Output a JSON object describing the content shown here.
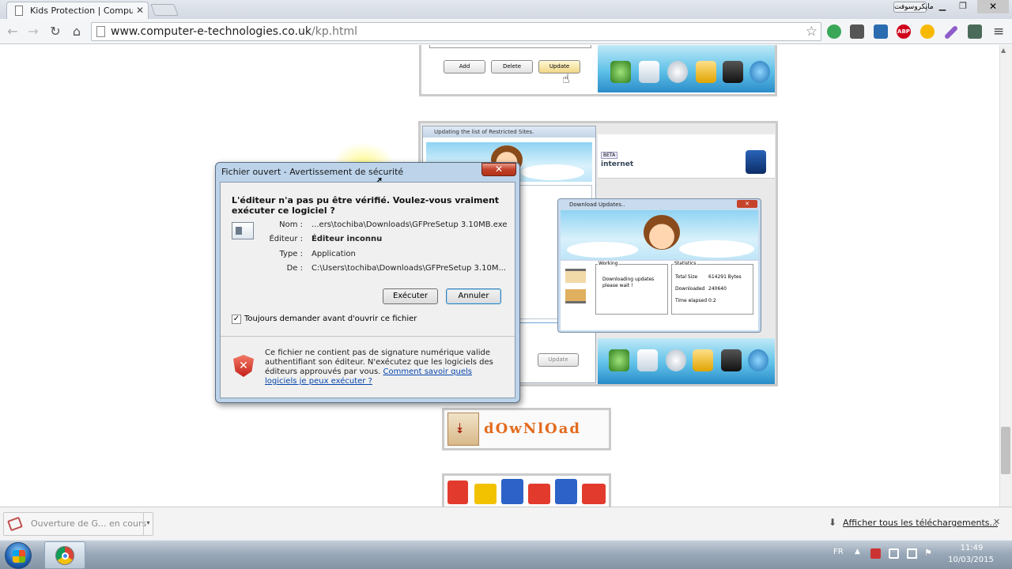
{
  "browser": {
    "tab_title": "Kids Protection | Compute",
    "tab_close": "✕",
    "user_button": "مايكروسوفت",
    "url_host": "www.computer-e-technologies.co.uk",
    "url_path": "/kp.html"
  },
  "page": {
    "top_panel": {
      "add": "Add",
      "delete": "Delete",
      "update": "Update"
    },
    "middle_panel": {
      "window_title": "Updating the list of Restricted Sites.",
      "beta_badge": "BETA",
      "product_text": "internet",
      "update_button": "Update"
    },
    "download_updates": {
      "title": "Download Updates..",
      "working_label": "Working",
      "working_text": "Downloading updates please wait !",
      "statistics_label": "Statistics",
      "stats": [
        {
          "label": "Total Size",
          "value": "614291 Bytes"
        },
        {
          "label": "Downloaded",
          "value": "240640"
        },
        {
          "label": "Time elapsed",
          "value": "0:2"
        }
      ]
    },
    "download_banner": "dOwNlOad"
  },
  "dialog": {
    "title": "Fichier ouvert - Avertissement de sécurité",
    "question": "L'éditeur n'a pas pu être vérifié. Voulez-vous vraiment exécuter ce logiciel ?",
    "fields": [
      {
        "label": "Nom :",
        "value": "...ers\\tochiba\\Downloads\\GFPreSetup 3.10MB.exe",
        "bold": false
      },
      {
        "label": "Éditeur :",
        "value": "Éditeur inconnu",
        "bold": true
      },
      {
        "label": "Type :",
        "value": "Application",
        "bold": false
      },
      {
        "label": "De :",
        "value": "C:\\Users\\tochiba\\Downloads\\GFPreSetup 3.10M...",
        "bold": false
      }
    ],
    "run_button": "Exécuter",
    "cancel_button": "Annuler",
    "checkbox_label": "Toujours demander avant d'ouvrir ce fichier",
    "checkbox_checked": true,
    "warning_text": "Ce fichier ne contient pas de signature numérique valide authentifiant son éditeur. N'exécutez que les logiciels des éditeurs approuvés par vous.",
    "warning_link": "Comment savoir quels logiciels je peux exécuter ?"
  },
  "shelf": {
    "item_label": "Ouverture de G... en cours",
    "show_all": "Afficher tous les téléchargements..."
  },
  "taskbar": {
    "language": "FR",
    "time": "11:49",
    "date": "10/03/2015"
  },
  "colors": {
    "dialog_frame": "#bcd3ea",
    "close_red": "#c3402a",
    "link_blue": "#0645ad",
    "toolbar_blue": "#5fc1e8"
  }
}
